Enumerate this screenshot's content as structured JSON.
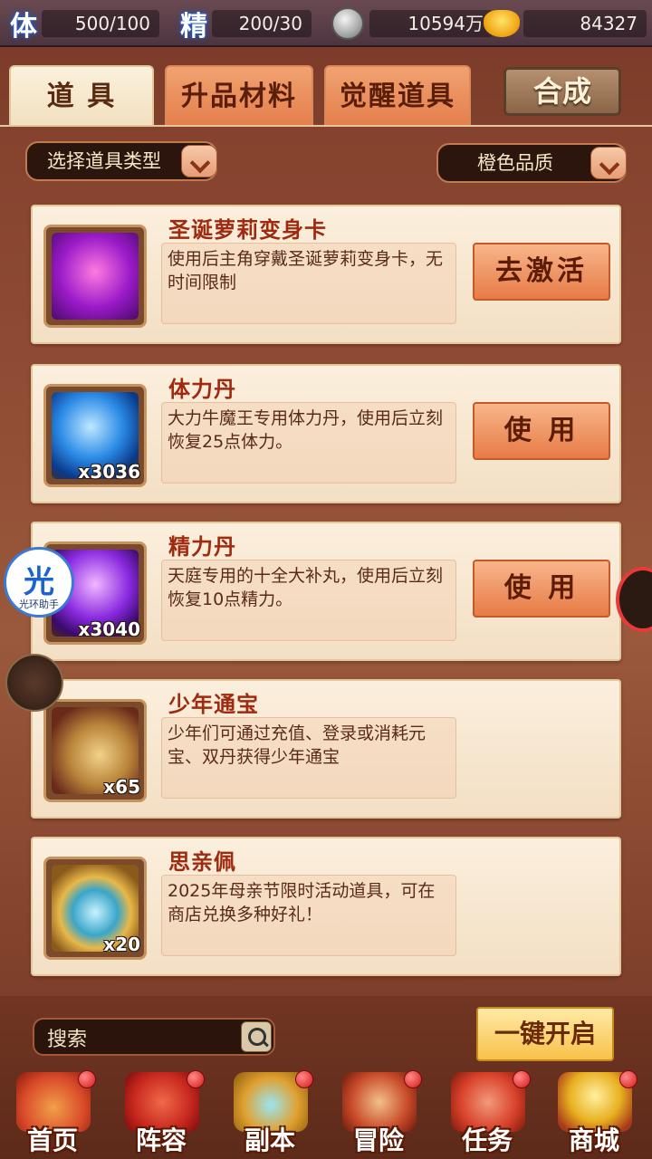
{
  "topbar": {
    "stamina_label": "体",
    "stamina_value": "500/100",
    "energy_label": "精",
    "energy_value": "200/30",
    "silver_icon": "silver-coin-icon",
    "silver_value": "10594万",
    "gold_icon": "gold-ingot-icon",
    "gold_value": "84327"
  },
  "tabs": [
    {
      "label": "道 具",
      "active": true
    },
    {
      "label": "升品材料",
      "active": false
    },
    {
      "label": "觉醒道具",
      "active": false
    }
  ],
  "combine_label": "合成",
  "filters": {
    "type_label": "选择道具类型",
    "quality_label": "橙色品质"
  },
  "items": [
    {
      "name": "圣诞萝莉变身卡",
      "desc": "使用后主角穿戴圣诞萝莉变身卡，无时间限制",
      "count": "",
      "button": "去激活",
      "icon": "transform-card-icon",
      "color": "#b43ad0"
    },
    {
      "name": "体力丹",
      "desc": "大力牛魔王专用体力丹，使用后立刻恢复25点体力。",
      "count": "x3036",
      "button": "使 用",
      "icon": "blue-pill-icon",
      "color": "#2a8ae6"
    },
    {
      "name": "精力丹",
      "desc": "天庭专用的十全大补丸，使用后立刻恢复10点精力。",
      "count": "x3040",
      "button": "使 用",
      "icon": "purple-pill-icon",
      "color": "#8a2ae0"
    },
    {
      "name": "少年通宝",
      "desc": "少年们可通过充值、登录或消耗元宝、双丹获得少年通宝",
      "count": "x65",
      "button": "",
      "icon": "coin-string-icon",
      "color": "#c08a3a"
    },
    {
      "name": "思亲佩",
      "desc": "2025年母亲节限时活动道具，可在商店兑换多种好礼！",
      "count": "x20",
      "button": "",
      "icon": "jade-pendant-icon",
      "color": "#3aa6c8"
    }
  ],
  "search_placeholder": "搜索",
  "onekey_label": "一键开启",
  "nav": [
    {
      "label": "首页",
      "icon": "home-gate-icon",
      "color": "#d94a2a"
    },
    {
      "label": "阵容",
      "icon": "formation-banner-icon",
      "color": "#c8281e"
    },
    {
      "label": "副本",
      "icon": "dungeon-icon",
      "color": "#e0a030"
    },
    {
      "label": "冒险",
      "icon": "adventure-scroll-icon",
      "color": "#c84a2a"
    },
    {
      "label": "任务",
      "icon": "quest-icon",
      "color": "#d8402a"
    },
    {
      "label": "商城",
      "icon": "shop-ingot-icon",
      "color": "#e8b020"
    }
  ],
  "floating": {
    "helper_big": "光",
    "helper_small": "光环助手"
  }
}
